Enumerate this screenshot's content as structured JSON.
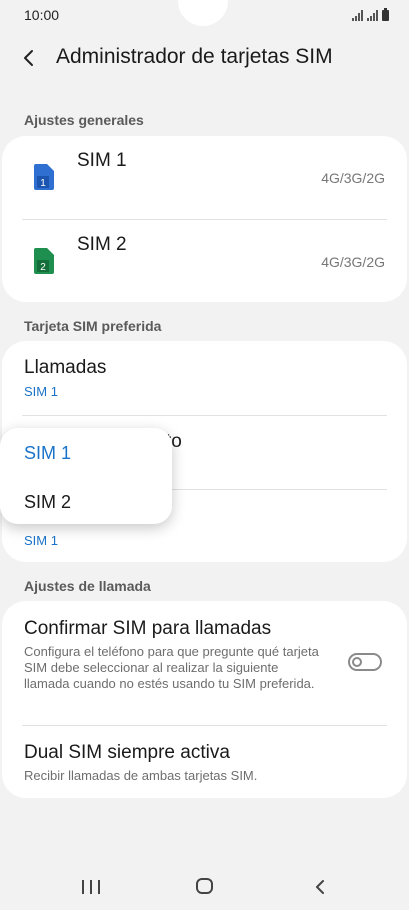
{
  "status_bar": {
    "time": "10:00"
  },
  "header": {
    "title": "Administrador de tarjetas SIM"
  },
  "sections": {
    "general": "Ajustes generales",
    "preferred": "Tarjeta SIM preferida",
    "calls": "Ajustes de llamada"
  },
  "sims": [
    {
      "name": "SIM 1",
      "number": "1",
      "network": "4G/3G/2G",
      "color": "#2f6fd1"
    },
    {
      "name": "SIM 2",
      "number": "2",
      "network": "4G/3G/2G",
      "color": "#1e8f4e"
    }
  ],
  "preferred": {
    "calls": {
      "label": "Llamadas",
      "value": "SIM 1"
    },
    "row2": {
      "label_visible": "to"
    },
    "row3": {
      "value": "SIM 1"
    }
  },
  "call_settings": {
    "confirm": {
      "title": "Confirmar SIM para llamadas",
      "desc": "Configura el teléfono para que pregunte qué tarjeta SIM debe seleccionar al realizar la siguiente llamada cuando no estés usando tu SIM preferida.",
      "enabled": false
    },
    "dual": {
      "title": "Dual SIM siempre activa",
      "desc": "Recibir llamadas de ambas tarjetas SIM."
    }
  },
  "popup": {
    "options": [
      "SIM 1",
      "SIM 2"
    ],
    "selected": "SIM 1"
  },
  "colors": {
    "accent": "#1a73c8",
    "background": "#f2f2f2",
    "card": "#ffffff"
  },
  "navbar": {
    "icons": [
      "recent-apps-icon",
      "home-icon",
      "back-icon"
    ]
  }
}
